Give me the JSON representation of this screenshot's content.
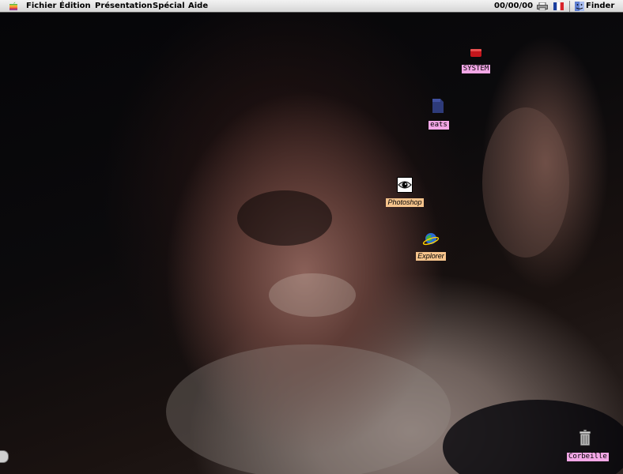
{
  "menubar": {
    "apple_menu_icon": "apple-icon",
    "items": [
      "Fichier",
      "Édition",
      "Présentation",
      "Spécial",
      "Aide"
    ],
    "clock": "00/00/00",
    "printer_icon": "printer-icon",
    "keyboard_flag_icon": "french-flag-icon",
    "app_name": "Finder",
    "app_icon": "finder-icon"
  },
  "desktop": {
    "icons": [
      {
        "label": "SYSTEM",
        "icon": "red-hard-drive-icon",
        "label_color": "#f2a7e6"
      },
      {
        "label": "eats",
        "icon": "folder-icon",
        "label_color": "#f2a7e6"
      },
      {
        "label": "Photoshop",
        "icon": "photoshop-eye-icon",
        "label_color": "#f6c48c"
      },
      {
        "label": "Explorer",
        "icon": "internet-explorer-icon",
        "label_color": "#f6c48c"
      },
      {
        "label": "Corbeille",
        "icon": "trash-icon",
        "label_color": "#f2a7e6"
      }
    ]
  }
}
